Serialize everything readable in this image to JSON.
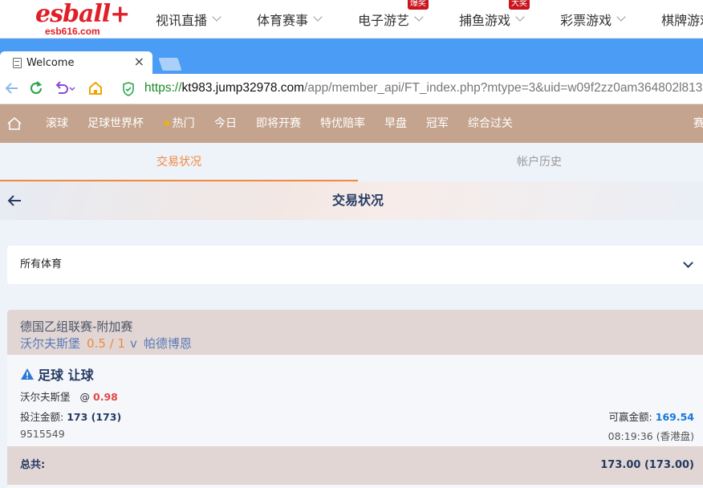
{
  "site": {
    "logo_text": "esball+",
    "logo_domain": "esb616.com",
    "nav": [
      {
        "label": "视讯直播",
        "badge": ""
      },
      {
        "label": "体育赛事",
        "badge": ""
      },
      {
        "label": "电子游艺",
        "badge": "爆奖"
      },
      {
        "label": "捕鱼游戏",
        "badge": "大奖"
      },
      {
        "label": "彩票游戏",
        "badge": ""
      },
      {
        "label": "棋牌游戏",
        "badge": ""
      }
    ]
  },
  "browser": {
    "tab_title": "Welcome",
    "tab_close": "×",
    "url_scheme": "https://",
    "url_host": "kt983.jump32978.com",
    "url_path": "/app/member_api/FT_index.php?mtype=3&uid=w09f2zz0am364802l8137&"
  },
  "sport_nav": {
    "items": [
      "滚球",
      "足球世界杯",
      "热门",
      "今日",
      "即将开赛",
      "特优赔率",
      "早盘",
      "冠军",
      "综合过关",
      "赛"
    ]
  },
  "tabs": {
    "active": "交易状况",
    "inactive": "帐户历史"
  },
  "page": {
    "title": "交易状况"
  },
  "filter": {
    "selected": "所有体育"
  },
  "bet": {
    "league": "德国乙组联赛-附加赛",
    "home": "沃尔夫斯堡",
    "line": "0.5 / 1",
    "vs": "v",
    "away": "帕德博恩",
    "type": "足球 让球",
    "selection": "沃尔夫斯堡",
    "at": "@",
    "odds": "0.98",
    "stake_label": "投注金额:",
    "stake_value": "173 (173)",
    "win_label": "可赢金额:",
    "win_value": "169.54",
    "ticket_id": "9515549",
    "time": "08:19:36 (香港盘)",
    "total_label": "总共:",
    "total_value": "173.00 (173.00)"
  },
  "colors": {
    "accent_orange": "#f0893c",
    "sport_nav_bg": "#c4a48f",
    "browser_blue": "#4a9cf4",
    "odds_red": "#e04848",
    "win_blue": "#1778d8"
  }
}
